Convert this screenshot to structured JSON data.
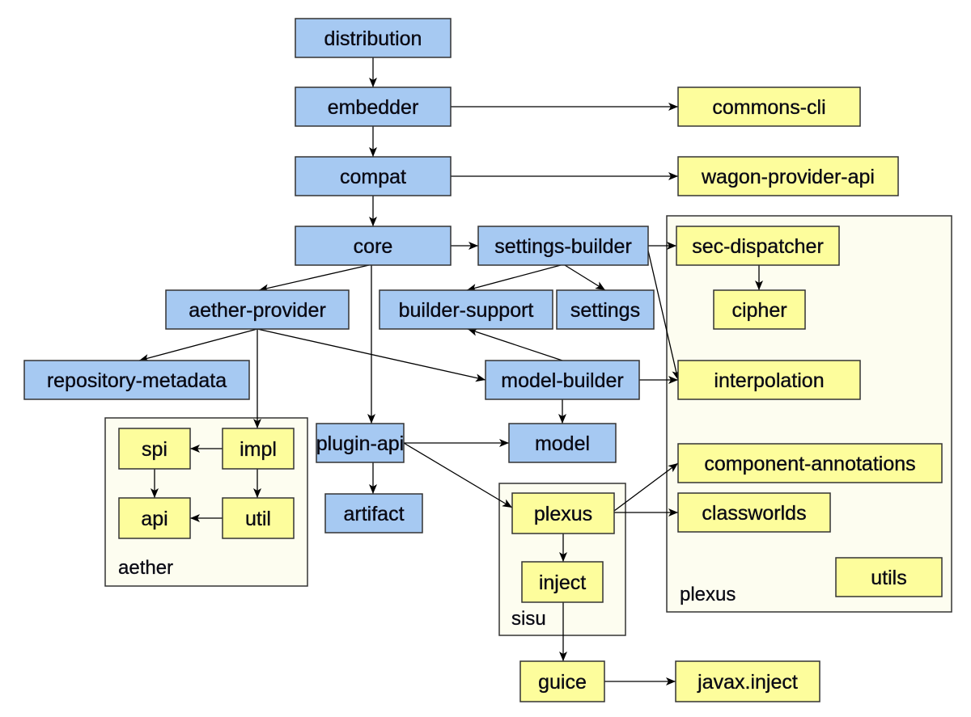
{
  "colors": {
    "maven_module": "#a6c9f2",
    "external": "#fdfd9c",
    "group_background": "#fdfdf0",
    "border": "#333333",
    "edge": "#000000"
  },
  "groups": [
    {
      "id": "g-plexus",
      "label": "plexus"
    },
    {
      "id": "g-aether",
      "label": "aether"
    },
    {
      "id": "g-sisu",
      "label": "sisu"
    }
  ],
  "nodes": [
    {
      "id": "distribution",
      "label": "distribution",
      "kind": "maven_module"
    },
    {
      "id": "embedder",
      "label": "embedder",
      "kind": "maven_module"
    },
    {
      "id": "compat",
      "label": "compat",
      "kind": "maven_module"
    },
    {
      "id": "core",
      "label": "core",
      "kind": "maven_module"
    },
    {
      "id": "settings-builder",
      "label": "settings-builder",
      "kind": "maven_module"
    },
    {
      "id": "aether-provider",
      "label": "aether-provider",
      "kind": "maven_module"
    },
    {
      "id": "builder-support",
      "label": "builder-support",
      "kind": "maven_module"
    },
    {
      "id": "settings",
      "label": "settings",
      "kind": "maven_module"
    },
    {
      "id": "repository-metadata",
      "label": "repository-metadata",
      "kind": "maven_module"
    },
    {
      "id": "model-builder",
      "label": "model-builder",
      "kind": "maven_module"
    },
    {
      "id": "plugin-api",
      "label": "plugin-api",
      "kind": "maven_module"
    },
    {
      "id": "model",
      "label": "model",
      "kind": "maven_module"
    },
    {
      "id": "artifact",
      "label": "artifact",
      "kind": "maven_module"
    },
    {
      "id": "commons-cli",
      "label": "commons-cli",
      "kind": "external"
    },
    {
      "id": "wagon-provider-api",
      "label": "wagon-provider-api",
      "kind": "external"
    },
    {
      "id": "sec-dispatcher",
      "label": "sec-dispatcher",
      "kind": "external",
      "group": "plexus"
    },
    {
      "id": "cipher",
      "label": "cipher",
      "kind": "external",
      "group": "plexus"
    },
    {
      "id": "interpolation",
      "label": "interpolation",
      "kind": "external",
      "group": "plexus"
    },
    {
      "id": "component-annotations",
      "label": "component-annotations",
      "kind": "external",
      "group": "plexus"
    },
    {
      "id": "classworlds",
      "label": "classworlds",
      "kind": "external",
      "group": "plexus"
    },
    {
      "id": "utils",
      "label": "utils",
      "kind": "external",
      "group": "plexus"
    },
    {
      "id": "spi",
      "label": "spi",
      "kind": "external",
      "group": "aether"
    },
    {
      "id": "impl",
      "label": "impl",
      "kind": "external",
      "group": "aether"
    },
    {
      "id": "api",
      "label": "api",
      "kind": "external",
      "group": "aether"
    },
    {
      "id": "util",
      "label": "util",
      "kind": "external",
      "group": "aether"
    },
    {
      "id": "sisu-plexus",
      "label": "plexus",
      "kind": "external",
      "group": "sisu"
    },
    {
      "id": "inject",
      "label": "inject",
      "kind": "external",
      "group": "sisu"
    },
    {
      "id": "guice",
      "label": "guice",
      "kind": "external"
    },
    {
      "id": "javax-inject",
      "label": "javax.inject",
      "kind": "external"
    }
  ],
  "edges": [
    {
      "from": "distribution",
      "to": "embedder"
    },
    {
      "from": "embedder",
      "to": "compat"
    },
    {
      "from": "embedder",
      "to": "commons-cli"
    },
    {
      "from": "compat",
      "to": "core"
    },
    {
      "from": "compat",
      "to": "wagon-provider-api"
    },
    {
      "from": "core",
      "to": "settings-builder"
    },
    {
      "from": "core",
      "to": "aether-provider"
    },
    {
      "from": "core",
      "to": "plugin-api"
    },
    {
      "from": "settings-builder",
      "to": "sec-dispatcher"
    },
    {
      "from": "settings-builder",
      "to": "builder-support"
    },
    {
      "from": "settings-builder",
      "to": "settings"
    },
    {
      "from": "settings-builder",
      "to": "interpolation"
    },
    {
      "from": "sec-dispatcher",
      "to": "cipher"
    },
    {
      "from": "aether-provider",
      "to": "repository-metadata"
    },
    {
      "from": "aether-provider",
      "to": "model-builder"
    },
    {
      "from": "aether-provider",
      "to": "impl"
    },
    {
      "from": "model-builder",
      "to": "builder-support"
    },
    {
      "from": "model-builder",
      "to": "interpolation"
    },
    {
      "from": "model-builder",
      "to": "model"
    },
    {
      "from": "plugin-api",
      "to": "model"
    },
    {
      "from": "plugin-api",
      "to": "artifact"
    },
    {
      "from": "plugin-api",
      "to": "sisu-plexus"
    },
    {
      "from": "impl",
      "to": "spi"
    },
    {
      "from": "impl",
      "to": "util"
    },
    {
      "from": "spi",
      "to": "api"
    },
    {
      "from": "util",
      "to": "api"
    },
    {
      "from": "sisu-plexus",
      "to": "inject"
    },
    {
      "from": "sisu-plexus",
      "to": "component-annotations"
    },
    {
      "from": "sisu-plexus",
      "to": "classworlds"
    },
    {
      "from": "inject",
      "to": "guice"
    },
    {
      "from": "guice",
      "to": "javax-inject"
    }
  ]
}
